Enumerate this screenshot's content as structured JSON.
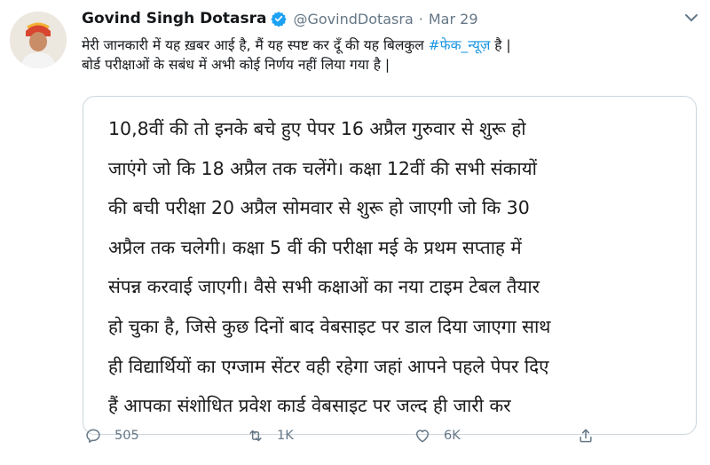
{
  "header": {
    "name": "Govind Singh Dotasra",
    "handle": "@GovindDotasra",
    "separator": "·",
    "date": "Mar 29"
  },
  "tweet": {
    "text_part1": "मेरी जानकारी में यह ख़बर आई है, मैं यह स्पष्ट कर दूँ की यह बिलकुल ",
    "hashtag": "#फेक_न्यूज़",
    "text_part2": " है |",
    "text_line2": "बोर्ड परीक्षाओं के सबंध में अभी कोई निर्णय नहीं लिया गया है |"
  },
  "card": {
    "lines": [
      "10,8वीं की तो इनके बचे हुए पेपर 16 अप्रैल गुरुवार से शुरू हो",
      "जाएंगे जो कि 18 अप्रैल तक चलेंगे। कक्षा 12वीं की सभी संकायों",
      "की बची परीक्षा 20 अप्रैल सोमवार से शुरू हो जाएगी जो कि 30",
      "अप्रैल तक चलेगी। कक्षा 5 वीं की परीक्षा मई के प्रथम सप्ताह में",
      "संपन्न करवाई जाएगी। वैसे सभी कक्षाओं का नया टाइम टेबल तैयार",
      "हो चुका है, जिसे कुछ दिनों बाद वेबसाइट पर डाल दिया जाएगा साथ",
      "ही विद्यार्थियों का एग्जाम सेंटर वही रहेगा जहां आपने पहले पेपर दिए",
      "हैं आपका संशोधित प्रवेश कार्ड वेबसाइट पर जल्द ही जारी कर"
    ]
  },
  "actions": {
    "reply_count": "505",
    "retweet_count": "1K",
    "like_count": "6K"
  },
  "colors": {
    "hashtag": "#1b95e0",
    "verified": "#1da1f2",
    "muted": "#657786"
  },
  "icons": [
    "verified-badge-icon",
    "chevron-down-icon",
    "reply-icon",
    "retweet-icon",
    "like-icon",
    "share-icon"
  ]
}
